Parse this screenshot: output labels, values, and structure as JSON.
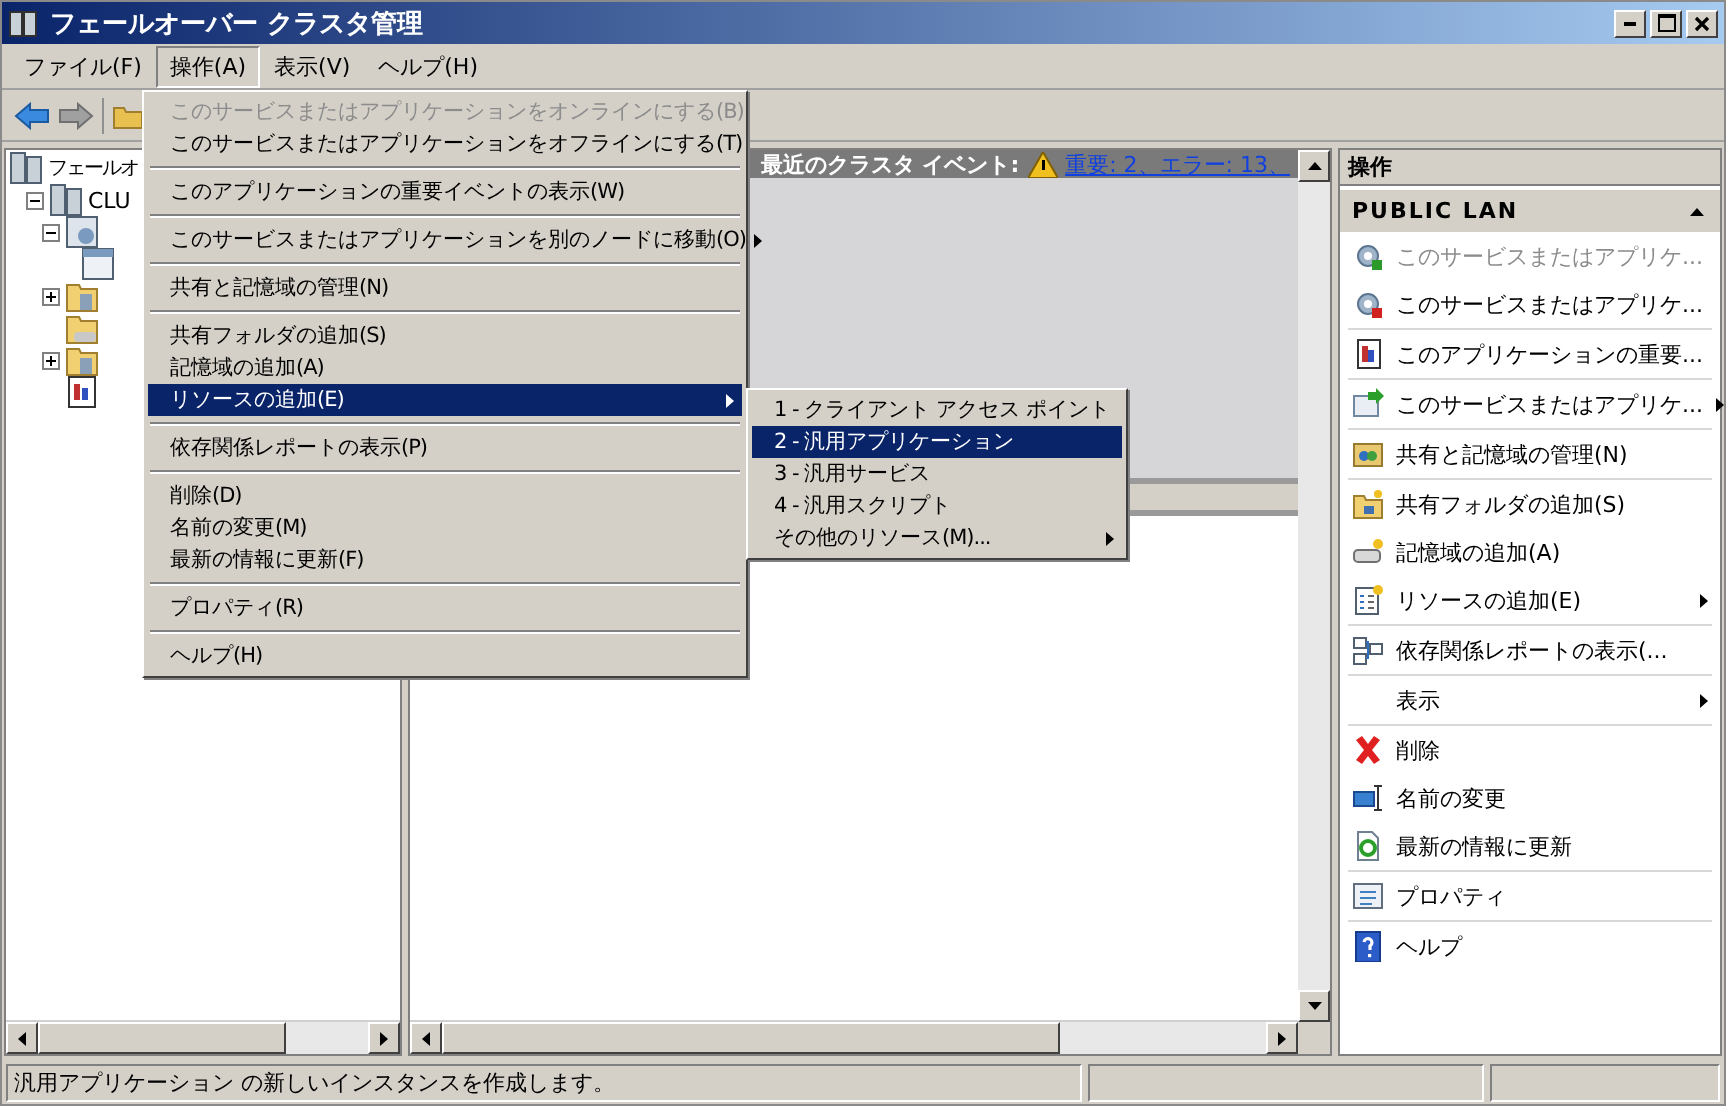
{
  "window": {
    "title": "フェールオーバー クラスタ管理"
  },
  "menu_bar": [
    {
      "label": "ファイル(F)",
      "selected": false
    },
    {
      "label": "操作(A)",
      "selected": true
    },
    {
      "label": "表示(V)",
      "selected": false
    },
    {
      "label": "ヘルプ(H)",
      "selected": false
    }
  ],
  "tree": [
    {
      "label": "フェールオ",
      "children": [
        {
          "label": "CLU",
          "expanded": true,
          "children": [
            {
              "kind": "services",
              "expanded": true,
              "children": [
                {
                  "kind": "application"
                }
              ]
            },
            {
              "kind": "nodes",
              "expanded": false
            },
            {
              "kind": "storage"
            },
            {
              "kind": "networks",
              "expanded": false
            },
            {
              "kind": "events"
            }
          ]
        }
      ]
    }
  ],
  "events_header": {
    "label": "最近のクラスタ イベント:",
    "link": "重要: 2、エラー: 13、"
  },
  "action_menu": {
    "groups": [
      [
        {
          "label": "このサービスまたはアプリケーションをオンラインにする(B)",
          "disabled": true,
          "selected": false,
          "submenu": false
        },
        {
          "label": "このサービスまたはアプリケーションをオフラインにする(T)",
          "disabled": false,
          "selected": false,
          "submenu": false
        }
      ],
      [
        {
          "label": "このアプリケーションの重要イベントの表示(W)",
          "disabled": false,
          "selected": false,
          "submenu": false
        }
      ],
      [
        {
          "label": "このサービスまたはアプリケーションを別のノードに移動(O)",
          "disabled": false,
          "selected": false,
          "submenu": true
        }
      ],
      [
        {
          "label": "共有と記憶域の管理(N)",
          "disabled": false,
          "selected": false,
          "submenu": false
        }
      ],
      [
        {
          "label": "共有フォルダの追加(S)",
          "disabled": false,
          "selected": false,
          "submenu": false
        },
        {
          "label": "記憶域の追加(A)",
          "disabled": false,
          "selected": false,
          "submenu": false
        },
        {
          "label": "リソースの追加(E)",
          "disabled": false,
          "selected": true,
          "submenu": true
        }
      ],
      [
        {
          "label": "依存関係レポートの表示(P)",
          "disabled": false,
          "selected": false,
          "submenu": false
        }
      ],
      [
        {
          "label": "削除(D)",
          "disabled": false,
          "selected": false,
          "submenu": false
        },
        {
          "label": "名前の変更(M)",
          "disabled": false,
          "selected": false,
          "submenu": false
        },
        {
          "label": "最新の情報に更新(F)",
          "disabled": false,
          "selected": false,
          "submenu": false
        }
      ],
      [
        {
          "label": "プロパティ(R)",
          "disabled": false,
          "selected": false,
          "submenu": false
        }
      ],
      [
        {
          "label": "ヘルプ(H)",
          "disabled": false,
          "selected": false,
          "submenu": false
        }
      ]
    ]
  },
  "resource_submenu": {
    "items": [
      {
        "label": "1 - クライアント アクセス ポイント",
        "selected": false,
        "submenu": false
      },
      {
        "label": "2 - 汎用アプリケーション",
        "selected": true,
        "submenu": false
      },
      {
        "label": "3 - 汎用サービス",
        "selected": false,
        "submenu": false
      },
      {
        "label": "4 - 汎用スクリプト",
        "selected": false,
        "submenu": false
      },
      {
        "label": "その他のリソース(M)...",
        "selected": false,
        "submenu": true
      }
    ]
  },
  "actions_pane": {
    "title": "操作",
    "section": "PUBLIC LAN",
    "groups": [
      [
        {
          "label": "このサービスまたはアプリケ...",
          "disabled": true,
          "submenu": false
        },
        {
          "label": "このサービスまたはアプリケ...",
          "disabled": false,
          "submenu": false
        }
      ],
      [
        {
          "label": "このアプリケーションの重要...",
          "disabled": false,
          "submenu": false
        }
      ],
      [
        {
          "label": "このサービスまたはアプリケ...",
          "disabled": false,
          "submenu": true
        }
      ],
      [
        {
          "label": "共有と記憶域の管理(N)",
          "disabled": false,
          "submenu": false
        }
      ],
      [
        {
          "label": "共有フォルダの追加(S)",
          "disabled": false,
          "submenu": false
        },
        {
          "label": "記憶域の追加(A)",
          "disabled": false,
          "submenu": false
        },
        {
          "label": "リソースの追加(E)",
          "disabled": false,
          "submenu": true
        }
      ],
      [
        {
          "label": "依存関係レポートの表示(...",
          "disabled": false,
          "submenu": false
        }
      ],
      [
        {
          "label": "表示",
          "disabled": false,
          "submenu": true
        }
      ],
      [
        {
          "label": "削除",
          "disabled": false,
          "submenu": false
        },
        {
          "label": "名前の変更",
          "disabled": false,
          "submenu": false
        },
        {
          "label": "最新の情報に更新",
          "disabled": false,
          "submenu": false
        }
      ],
      [
        {
          "label": "プロパティ",
          "disabled": false,
          "submenu": false
        }
      ],
      [
        {
          "label": "ヘルプ",
          "disabled": false,
          "submenu": false
        }
      ]
    ]
  },
  "status_bar": {
    "text": "汎用アプリケーション の新しいインスタンスを作成します。"
  }
}
